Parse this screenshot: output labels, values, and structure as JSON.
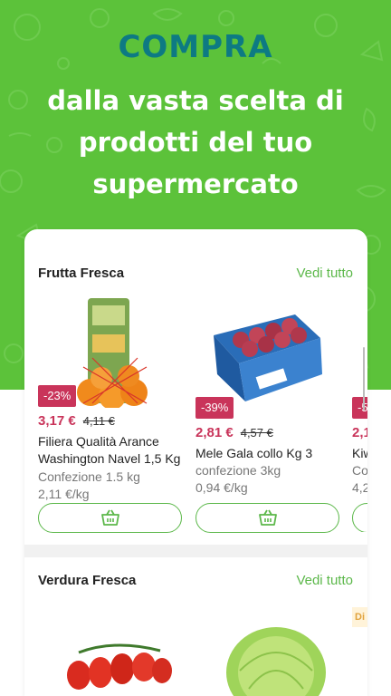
{
  "hero": {
    "title": "COMPRA",
    "subtitle": "dalla vasta scelta di prodotti del tuo supermercato",
    "bg_color": "#5cc23a",
    "title_color": "#0d7a83"
  },
  "sections": [
    {
      "title": "Frutta Fresca",
      "see_all": "Vedi tutto",
      "products": [
        {
          "discount": "-23%",
          "price": "3,17 €",
          "old_price": "4,11 €",
          "name_line1": "Filiera Qualità Arance",
          "name_line2": "Washington Navel 1,5 Kg",
          "pack": "Confezione 1.5 kg",
          "unit_price": "2,11 €/kg",
          "image_icon": "oranges-net-bag"
        },
        {
          "discount": "-39%",
          "price": "2,81 €",
          "old_price": "4,57 €",
          "name_line1": "Mele Gala collo Kg 3",
          "pack": "confezione 3kg",
          "unit_price": "0,94 €/kg",
          "image_icon": "apples-crate"
        },
        {
          "discount": "-5",
          "price": "2,1",
          "name_line1": "Kiw",
          "pack": "Co",
          "unit_price": "4,2"
        }
      ]
    },
    {
      "title": "Verdura Fresca",
      "see_all": "Vedi tutto",
      "badge": "Di",
      "products": [
        {
          "image_icon": "cherry-tomatoes"
        },
        {
          "image_icon": "iceberg-lettuce"
        }
      ]
    }
  ],
  "icons": {
    "cart": "cart-icon"
  },
  "colors": {
    "accent": "#5cb84a",
    "discount": "#c9345a"
  }
}
